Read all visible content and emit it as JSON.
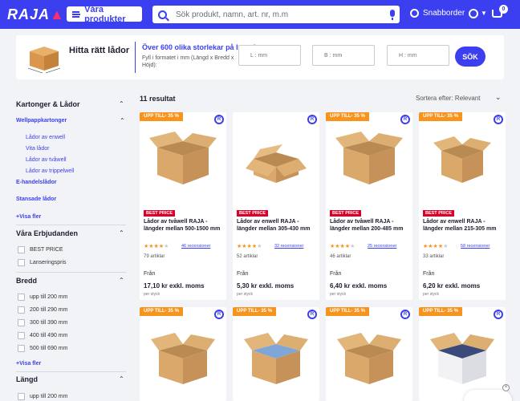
{
  "header": {
    "logo": "RAJA",
    "products_button": "Våra produkter",
    "search_placeholder": "Sök produkt, namn, art. nr, m.m",
    "quick_order": "Snabborder",
    "cart_count": "0"
  },
  "finder": {
    "title": "Hitta rätt lådor",
    "headline": "Över 600 olika storlekar på lager!",
    "subtitle": "Fyll i formatet i mm (Längd x Bredd x Höjd):",
    "length_placeholder": "L : mm",
    "width_placeholder": "B : mm",
    "height_placeholder": "H : mm",
    "search_button": "SÖK"
  },
  "sidebar": {
    "cat_title": "Kartonger & Lådor",
    "wellpapp": "Wellpappkartonger",
    "sub_items": [
      "Lådor av enwell",
      "Vita lådor",
      "Lådor av tvåwell",
      "Lådor av trippelwell"
    ],
    "ehandel": "E-handelslådor",
    "stansade": "Stansade lådor",
    "visa_fler": "+Visa fler",
    "offers_title": "Våra Erbjudanden",
    "offers": [
      "BEST PRICE",
      "Lanseringspris"
    ],
    "bredd_title": "Bredd",
    "bredd": [
      "upp till 200 mm",
      "200 till 290 mm",
      "300 till 390 mm",
      "400 till 490 mm",
      "500 till 690 mm"
    ],
    "bredd_more": "+Visa fler",
    "langd_title": "Längd",
    "langd": [
      "upp till 200 mm"
    ]
  },
  "results": {
    "count": "11 resultat",
    "sort": "Sortera efter: Relevant"
  },
  "products": [
    {
      "promo": "UPP TILL- 35 %",
      "badge": "BEST PRICE",
      "name": "Lådor av tvåwell RAJA - längder mellan 500-1500 mm",
      "rating": 4,
      "reviews": "46 recensioner",
      "articles": "79 artiklar",
      "from": "Från",
      "price": "17,10 kr exkl. moms",
      "per": "per styck"
    },
    {
      "promo": "",
      "badge": "BEST PRICE",
      "name": "Lådor av enwell RAJA - längder mellan 305-430 mm",
      "rating": 3,
      "reviews": "32 recensioner",
      "articles": "52 artiklar",
      "from": "Från",
      "price": "5,30 kr exkl. moms",
      "per": "per styck"
    },
    {
      "promo": "UPP TILL- 35 %",
      "badge": "BEST PRICE",
      "name": "Lådor av tvåwell RAJA - längder mellan 200-485 mm",
      "rating": 4,
      "reviews": "25 recensioner",
      "articles": "46 artiklar",
      "from": "Från",
      "price": "6,40 kr exkl. moms",
      "per": "per styck"
    },
    {
      "promo": "UPP TILL- 35 %",
      "badge": "BEST PRICE",
      "name": "Lådor av enwell RAJA - längder mellan 215-305 mm",
      "rating": 4,
      "reviews": "58 recensioner",
      "articles": "33 artiklar",
      "from": "Från",
      "price": "6,20 kr exkl. moms",
      "per": "per styck"
    },
    {
      "promo": "UPP TILL- 35 %"
    },
    {
      "promo": "UPP TILL- 35 %"
    },
    {
      "promo": "UPP TILL- 35 %"
    },
    {
      "promo": "UPP TILL- 35 %"
    }
  ],
  "colors": {
    "brand": "#3b3ff0",
    "promo": "#f7941d",
    "best_price": "#d6002a"
  }
}
